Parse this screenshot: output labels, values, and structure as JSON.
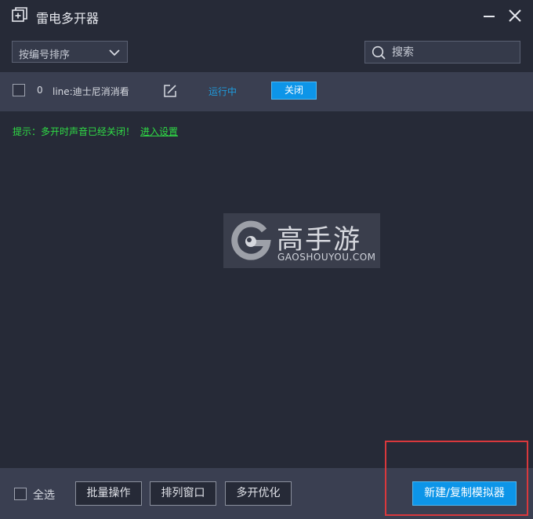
{
  "window": {
    "title": "雷电多开器"
  },
  "toolbar": {
    "sort_value": "按编号排序",
    "search_placeholder": "搜索"
  },
  "instances": [
    {
      "index": "0",
      "name": "line:迪士尼消消看",
      "status": "运行中",
      "action_label": "关闭"
    }
  ],
  "hint": {
    "text": "提示：多开时声音已经关闭！",
    "link": "进入设置"
  },
  "watermark": {
    "title": "高手游",
    "subtitle": "GAOSHOUYOU.COM"
  },
  "footer": {
    "select_all_label": "全选",
    "batch_label": "批量操作",
    "arrange_label": "排列窗口",
    "optimize_label": "多开优化",
    "new_label": "新建/复制模拟器"
  },
  "colors": {
    "background": "#262a37",
    "row_bg": "#3a3f51",
    "accent": "#0d95e8",
    "status_blue": "#1e9bdc",
    "hint_green": "#2fdc45",
    "highlight_red": "#d9383c"
  }
}
